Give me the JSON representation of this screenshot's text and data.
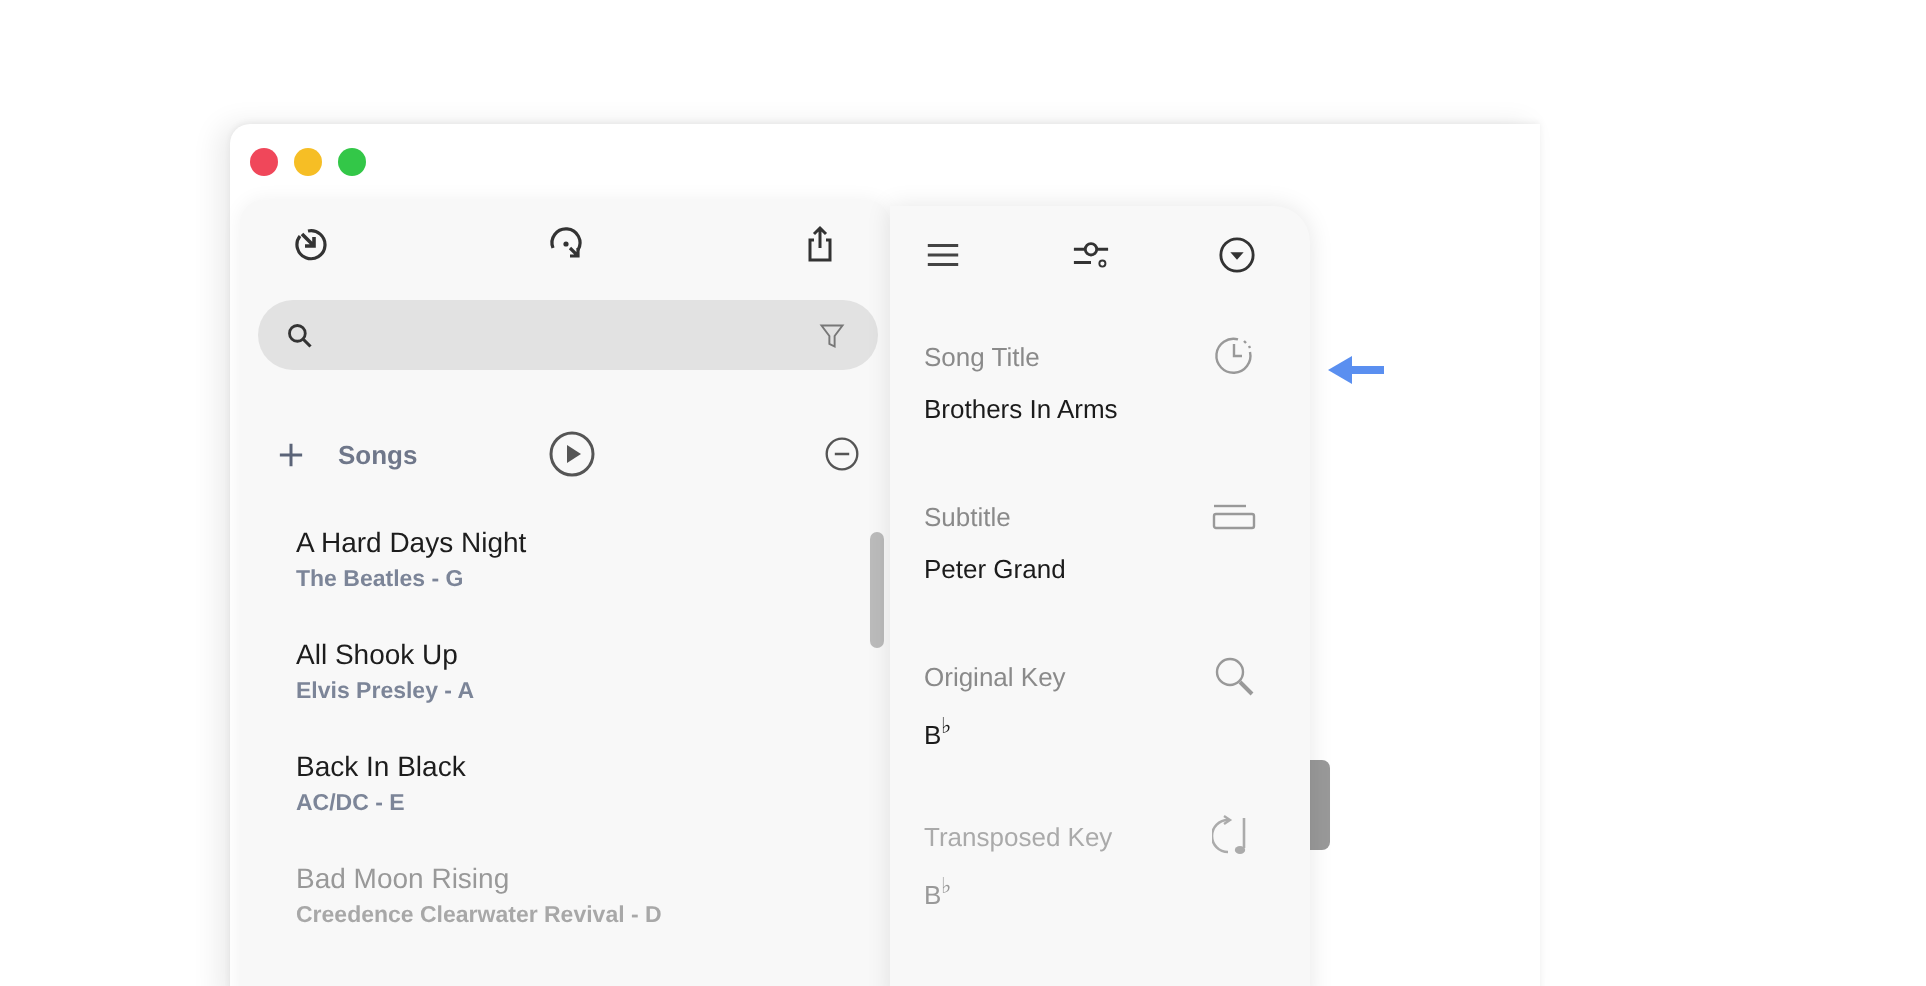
{
  "songs_panel": {
    "header": {
      "title": "Songs"
    },
    "songs": [
      {
        "title": "A Hard Days Night",
        "subtitle": "The Beatles - G",
        "faded": false
      },
      {
        "title": "All Shook Up",
        "subtitle": "Elvis Presley - A",
        "faded": false
      },
      {
        "title": "Back In Black",
        "subtitle": "AC/DC - E",
        "faded": false
      },
      {
        "title": "Bad Moon Rising",
        "subtitle": "Creedence Clearwater Revival - D",
        "faded": true
      }
    ]
  },
  "details_panel": {
    "fields": [
      {
        "label": "Song Title",
        "kind": "clock",
        "value": "Brothers In Arms",
        "faded": false
      },
      {
        "label": "Subtitle",
        "kind": "subtitle",
        "value": "Peter Grand",
        "faded": false
      },
      {
        "label": "Original Key",
        "kind": "search",
        "value": "B$^{♭}$",
        "faded": false
      },
      {
        "label": "Transposed Key",
        "kind": "transpose",
        "value": "B$^{♭}$",
        "faded": true
      }
    ]
  }
}
